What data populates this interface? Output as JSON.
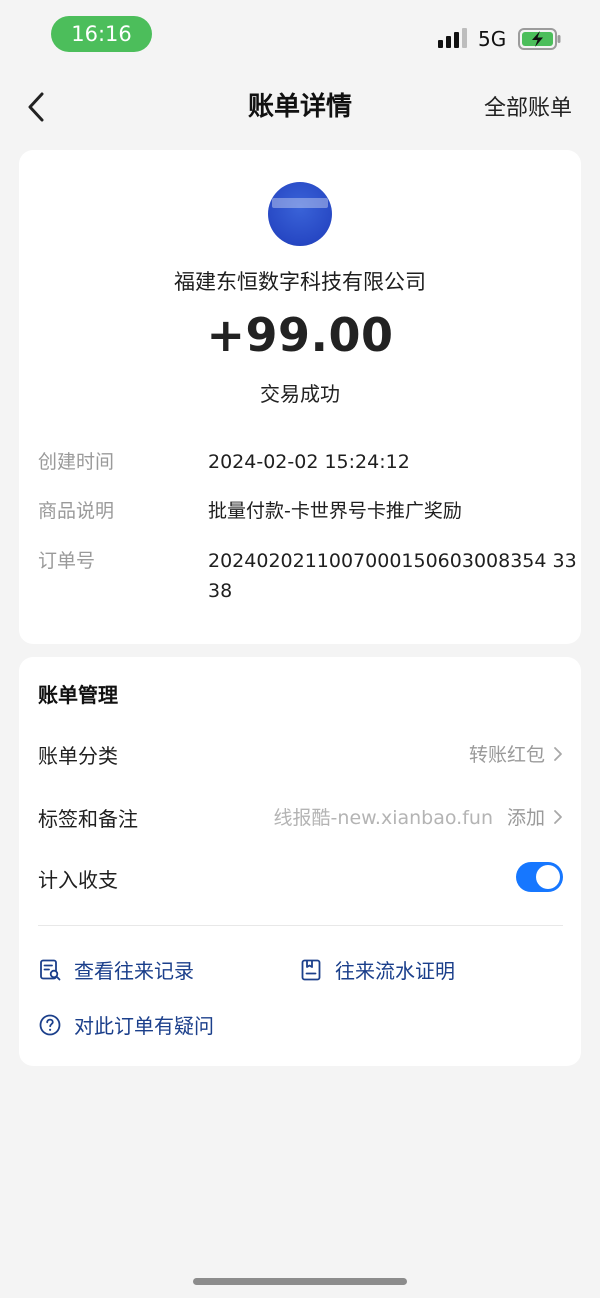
{
  "status_bar": {
    "time": "16:16",
    "network": "5G",
    "colors": {
      "time_pill": "#4cbe5b",
      "battery_fill": "#4cbe5b"
    }
  },
  "nav": {
    "title": "账单详情",
    "right_link": "全部账单"
  },
  "detail": {
    "merchant_name": "福建东恒数字科技有限公司",
    "amount": "+99.00",
    "status": "交易成功",
    "rows": [
      {
        "label": "创建时间",
        "value": "2024-02-02 15:24:12"
      },
      {
        "label": "商品说明",
        "value": "批量付款-卡世界号卡推广奖励"
      },
      {
        "label": "订单号",
        "value": "2024020211007000150603008354 3338"
      }
    ]
  },
  "manage": {
    "title": "账单管理",
    "category": {
      "label": "账单分类",
      "value": "转账红包"
    },
    "tags": {
      "label": "标签和备注",
      "watermark": "线报酷-new.xianbao.fun",
      "value": "添加"
    },
    "include": {
      "label": "计入收支",
      "enabled": true
    },
    "links": {
      "history": "查看往来记录",
      "proof": "往来流水证明",
      "question": "对此订单有疑问"
    },
    "colors": {
      "toggle_on": "#1677ff",
      "link": "#1b3f8b"
    }
  }
}
